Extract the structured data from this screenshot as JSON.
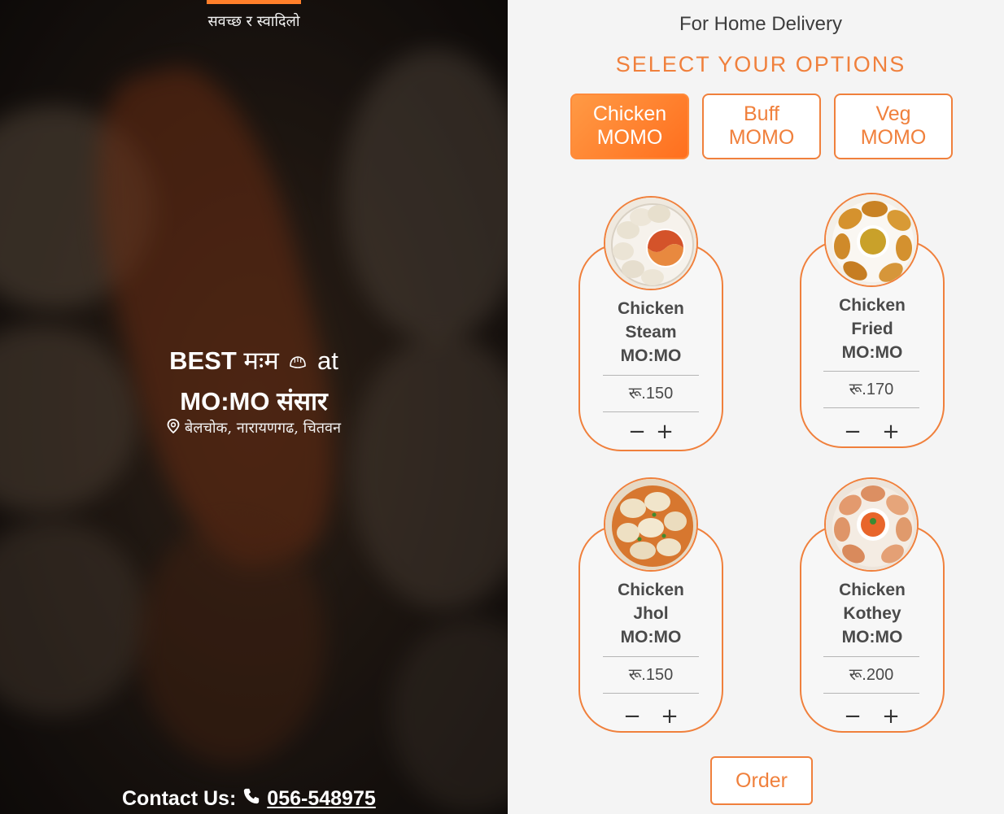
{
  "hero": {
    "tagline": "सवच्छ र स्वादिलो",
    "title_line1_bold": "BEST",
    "title_line1_dev": "मःम",
    "title_line1_at": "at",
    "title_line2": "MO:MO संसार",
    "location": "बेलचोक, नारायणगढ, चितवन",
    "contact_label": "Contact Us:",
    "contact_phone": "056-548975"
  },
  "panel": {
    "delivery_heading": "For Home Delivery",
    "select_heading": "SELECT YOUR OPTIONS",
    "tabs": [
      {
        "line1": "Chicken",
        "line2": "MOMO",
        "active": true
      },
      {
        "line1": "Buff",
        "line2": "MOMO",
        "active": false
      },
      {
        "line1": "Veg",
        "line2": "MOMO",
        "active": false
      }
    ],
    "items": [
      {
        "name1": "Chicken",
        "name2": "Steam",
        "name3": "MO:MO",
        "price": "रू.150"
      },
      {
        "name1": "Chicken",
        "name2": "Fried",
        "name3": "MO:MO",
        "price": "रू.170"
      },
      {
        "name1": "Chicken",
        "name2": "Jhol",
        "name3": "MO:MO",
        "price": "रू.150"
      },
      {
        "name1": "Chicken",
        "name2": "Kothey",
        "name3": "MO:MO",
        "price": "रू.200"
      }
    ],
    "order_label": "Order"
  },
  "qty": {
    "minus": "−",
    "plus": "+"
  },
  "colors": {
    "accent": "#f0803c",
    "tab_active": "#ff7f2a"
  }
}
